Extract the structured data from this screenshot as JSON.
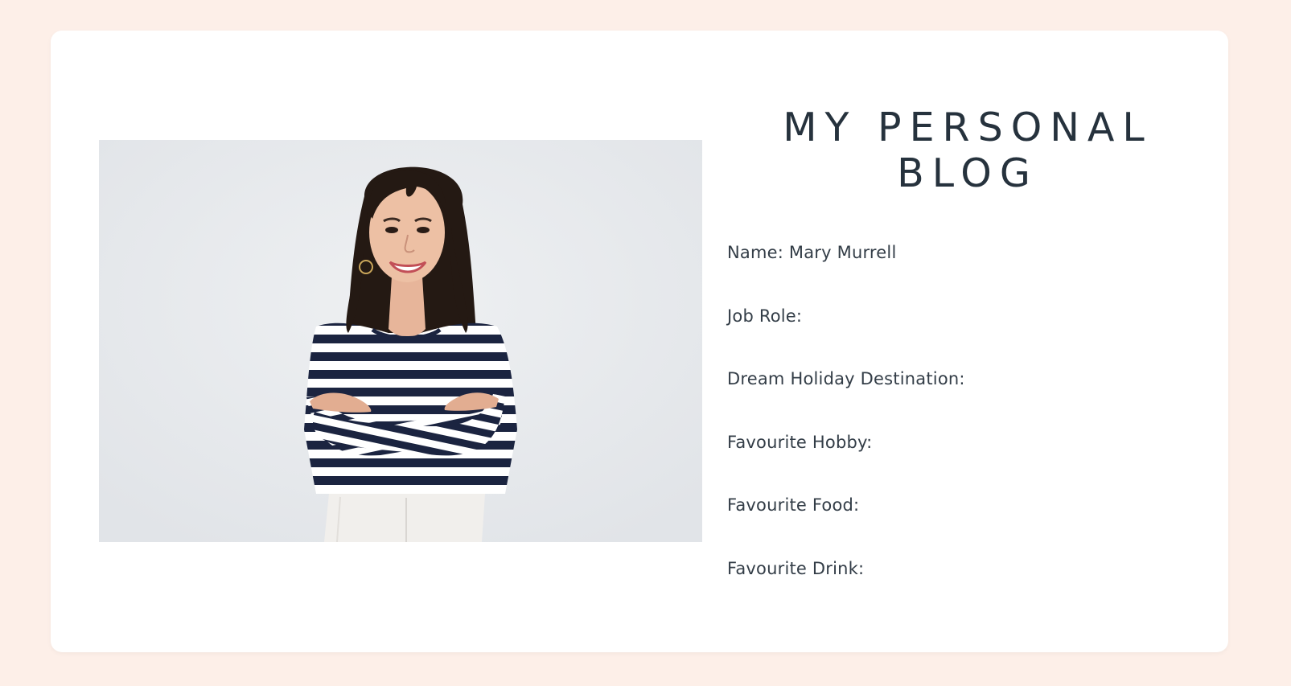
{
  "page": {
    "background_color": "#fdefe8",
    "card_color": "#ffffff",
    "text_color": "#2b3540"
  },
  "header": {
    "title": "MY PERSONAL BLOG"
  },
  "profile_image": {
    "alt": "Portrait of a smiling woman with long dark hair wearing a navy and white striped top, arms crossed"
  },
  "details": [
    {
      "label": "Name: Mary Murrell"
    },
    {
      "label": "Job Role:"
    },
    {
      "label": "Dream Holiday Destination:"
    },
    {
      "label": "Favourite Hobby:"
    },
    {
      "label": "Favourite Food:"
    },
    {
      "label": "Favourite Drink:"
    }
  ]
}
